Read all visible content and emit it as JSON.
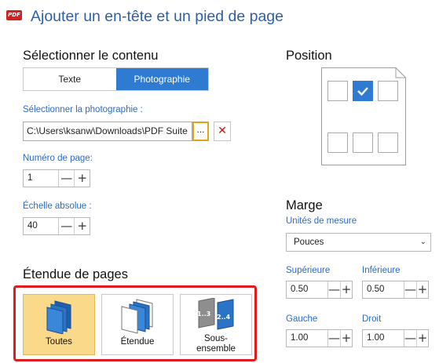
{
  "header": {
    "logo_text": "PDF",
    "title": "Ajouter un en-tête et un pied de page"
  },
  "content": {
    "heading": "Sélectionner le contenu",
    "tabs": [
      {
        "label": "Texte",
        "selected": false
      },
      {
        "label": "Photographie",
        "selected": true
      }
    ],
    "photo_label": "Sélectionner la photographie :",
    "photo_path": "C:\\Users\\ksanw\\Downloads\\PDF Suite",
    "browse_label": "...",
    "clear_label": "✕"
  },
  "page_number": {
    "label": "Numéro de page:",
    "value": "1"
  },
  "scale": {
    "label": "Échelle absolue :",
    "value": "40"
  },
  "position": {
    "heading": "Position",
    "selected_cell": "top-center"
  },
  "margin": {
    "heading": "Marge",
    "unit_label": "Unités de mesure",
    "unit_value": "Pouces",
    "top_label": "Supérieure",
    "top_value": "0.50",
    "bottom_label": "Inférieure",
    "bottom_value": "0.50",
    "left_label": "Gauche",
    "left_value": "1.00",
    "right_label": "Droit",
    "right_value": "1.00"
  },
  "range": {
    "heading": "Étendue de pages",
    "options": [
      {
        "label": "Toutes",
        "selected": true
      },
      {
        "label": "Étendue",
        "selected": false
      },
      {
        "label": "Sous-",
        "label2": "ensemble",
        "selected": false,
        "glyph1": "1..3",
        "glyph2": "2..4"
      }
    ]
  },
  "spinner": {
    "minus": "—",
    "plus": "+"
  },
  "colors": {
    "accent": "#2f7bd1",
    "title": "#2f5fa8",
    "highlight_border": "#e01b1b",
    "selected_tile": "#fbd98b"
  }
}
